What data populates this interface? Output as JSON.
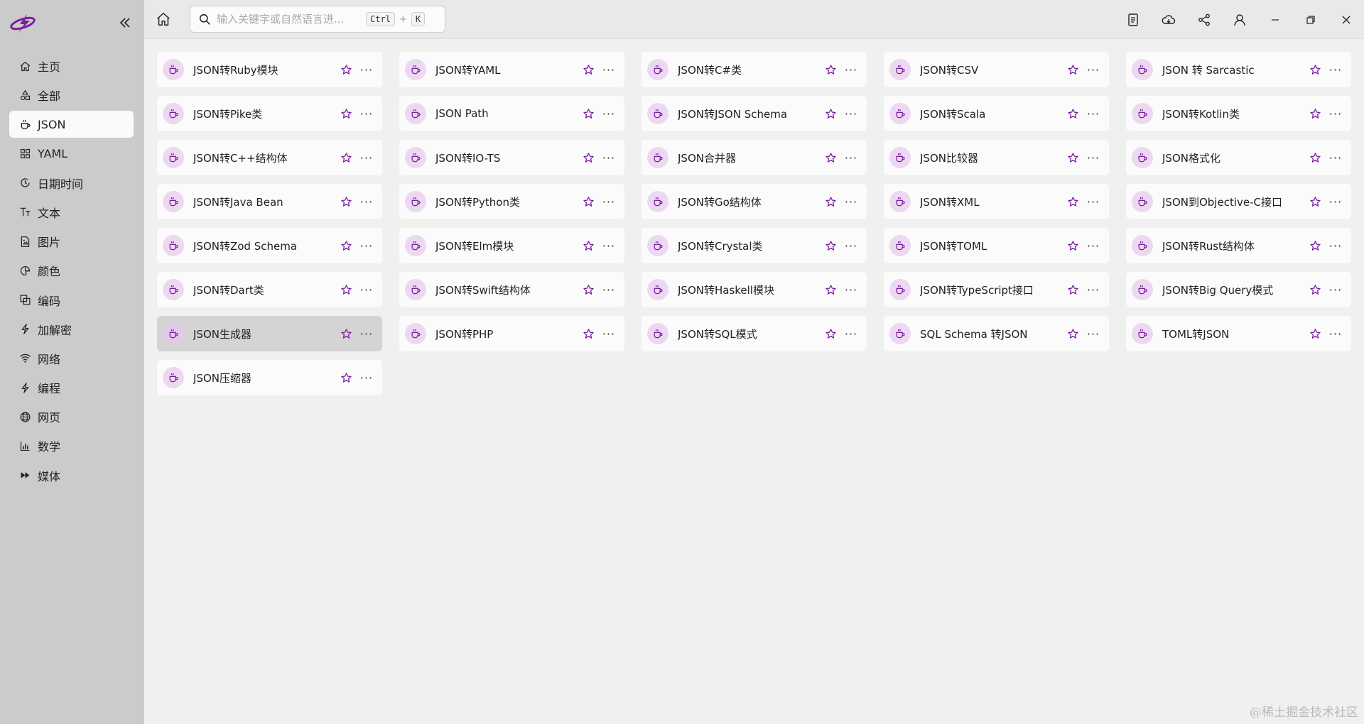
{
  "sidebar": {
    "collapse_icon": "double-chevron-left-icon",
    "items": [
      {
        "label": "主页",
        "icon": "home-icon"
      },
      {
        "label": "全部",
        "icon": "shapes-icon"
      },
      {
        "label": "JSON",
        "icon": "cup-icon",
        "active": true
      },
      {
        "label": "YAML",
        "icon": "grid-icon"
      },
      {
        "label": "日期时间",
        "icon": "clock-icon"
      },
      {
        "label": "文本",
        "icon": "text-icon"
      },
      {
        "label": "图片",
        "icon": "image-file-icon"
      },
      {
        "label": "颜色",
        "icon": "palette-icon"
      },
      {
        "label": "编码",
        "icon": "copy-icon"
      },
      {
        "label": "加解密",
        "icon": "bolt-icon"
      },
      {
        "label": "网络",
        "icon": "wifi-icon"
      },
      {
        "label": "编程",
        "icon": "bolt-icon"
      },
      {
        "label": "网页",
        "icon": "globe-icon"
      },
      {
        "label": "数学",
        "icon": "bar-chart-icon"
      },
      {
        "label": "媒体",
        "icon": "fast-forward-icon"
      }
    ]
  },
  "search": {
    "placeholder": "输入关键字或自然语言进...",
    "key1": "Ctrl",
    "plus": "+",
    "key2": "K"
  },
  "top_actions": [
    "document-icon",
    "cloud-icon",
    "share-icon",
    "user-icon",
    "minimize-icon",
    "restore-icon",
    "close-icon"
  ],
  "colors": {
    "accent": "#7b1fa2",
    "icon_bg": "#ecd9f1",
    "sidebar_bg": "#cbcbcb",
    "main_bg": "#f0f0f0"
  },
  "tools": [
    {
      "label": "JSON转Ruby模块"
    },
    {
      "label": "JSON转YAML"
    },
    {
      "label": "JSON转C#类"
    },
    {
      "label": "JSON转CSV"
    },
    {
      "label": "JSON 转 Sarcastic"
    },
    {
      "label": "JSON转Pike类"
    },
    {
      "label": "JSON Path"
    },
    {
      "label": "JSON转JSON Schema"
    },
    {
      "label": "JSON转Scala"
    },
    {
      "label": "JSON转Kotlin类"
    },
    {
      "label": "JSON转C++结构体"
    },
    {
      "label": "JSON转IO-TS"
    },
    {
      "label": "JSON合并器"
    },
    {
      "label": "JSON比较器"
    },
    {
      "label": "JSON格式化"
    },
    {
      "label": "JSON转Java Bean"
    },
    {
      "label": "JSON转Python类"
    },
    {
      "label": "JSON转Go结构体"
    },
    {
      "label": "JSON转XML"
    },
    {
      "label": "JSON到Objective-C接口"
    },
    {
      "label": "JSON转Zod Schema"
    },
    {
      "label": "JSON转Elm模块"
    },
    {
      "label": "JSON转Crystal类"
    },
    {
      "label": "JSON转TOML"
    },
    {
      "label": "JSON转Rust结构体"
    },
    {
      "label": "JSON转Dart类"
    },
    {
      "label": "JSON转Swift结构体"
    },
    {
      "label": "JSON转Haskell模块"
    },
    {
      "label": "JSON转TypeScript接口"
    },
    {
      "label": "JSON转Big Query模式"
    },
    {
      "label": "JSON生成器",
      "highlighted": true
    },
    {
      "label": "JSON转PHP"
    },
    {
      "label": "JSON转SQL模式"
    },
    {
      "label": "SQL Schema 转JSON"
    },
    {
      "label": "TOML转JSON"
    },
    {
      "label": "JSON压缩器"
    }
  ],
  "tool_icon": "cup-icon",
  "more_label": "···",
  "watermark": "@稀土掘金技术社区"
}
